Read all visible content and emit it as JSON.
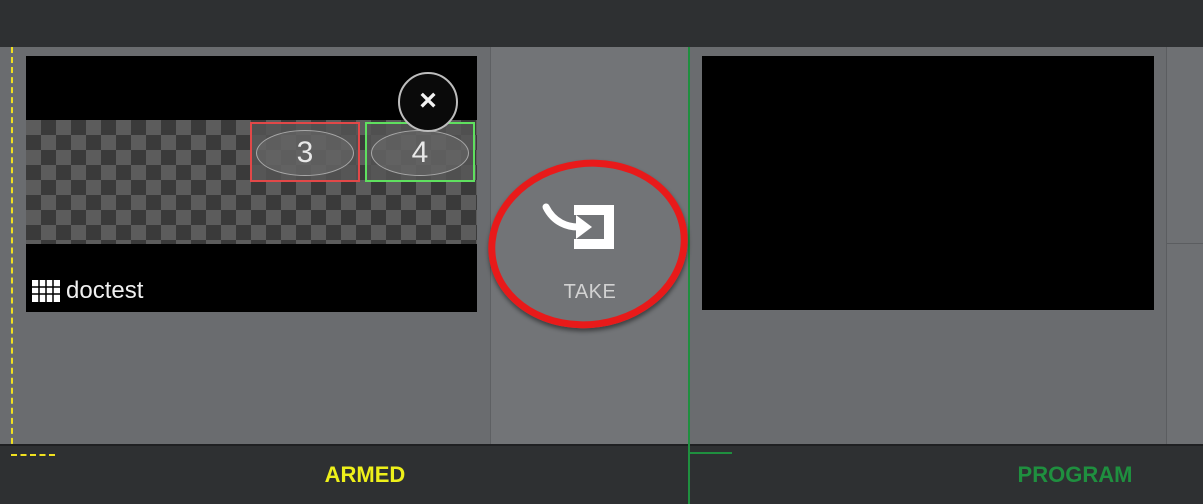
{
  "source": {
    "close_glyph": "×",
    "slots": [
      {
        "number": "3",
        "border_color": "#e24848"
      },
      {
        "number": "4",
        "border_color": "#5fe05f"
      }
    ],
    "label": "doctest",
    "label_icon": "grid-icon"
  },
  "take": {
    "label": "TAKE",
    "icon": "take-icon",
    "annotation_color": "#e81a1a"
  },
  "status": {
    "armed": "ARMED",
    "program": "PROGRAM"
  },
  "colors": {
    "armed": "#eef01a",
    "program": "#1f8f3f"
  }
}
